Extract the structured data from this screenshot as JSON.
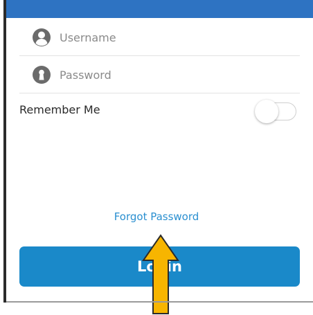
{
  "form": {
    "username_placeholder": "Username",
    "username_icon": "user-circle-icon",
    "password_placeholder": "Password",
    "password_icon": "keyhole-icon",
    "remember_label": "Remember Me",
    "remember_on": false,
    "forgot_label": "Forgot Password",
    "login_label": "Login"
  },
  "annotation": {
    "icon": "up-arrow-icon",
    "color": "#f7b500"
  },
  "colors": {
    "header": "#2e73c2",
    "accent_button": "#1a89c9",
    "link": "#2a8fd0",
    "icon": "#6b6b6b"
  }
}
